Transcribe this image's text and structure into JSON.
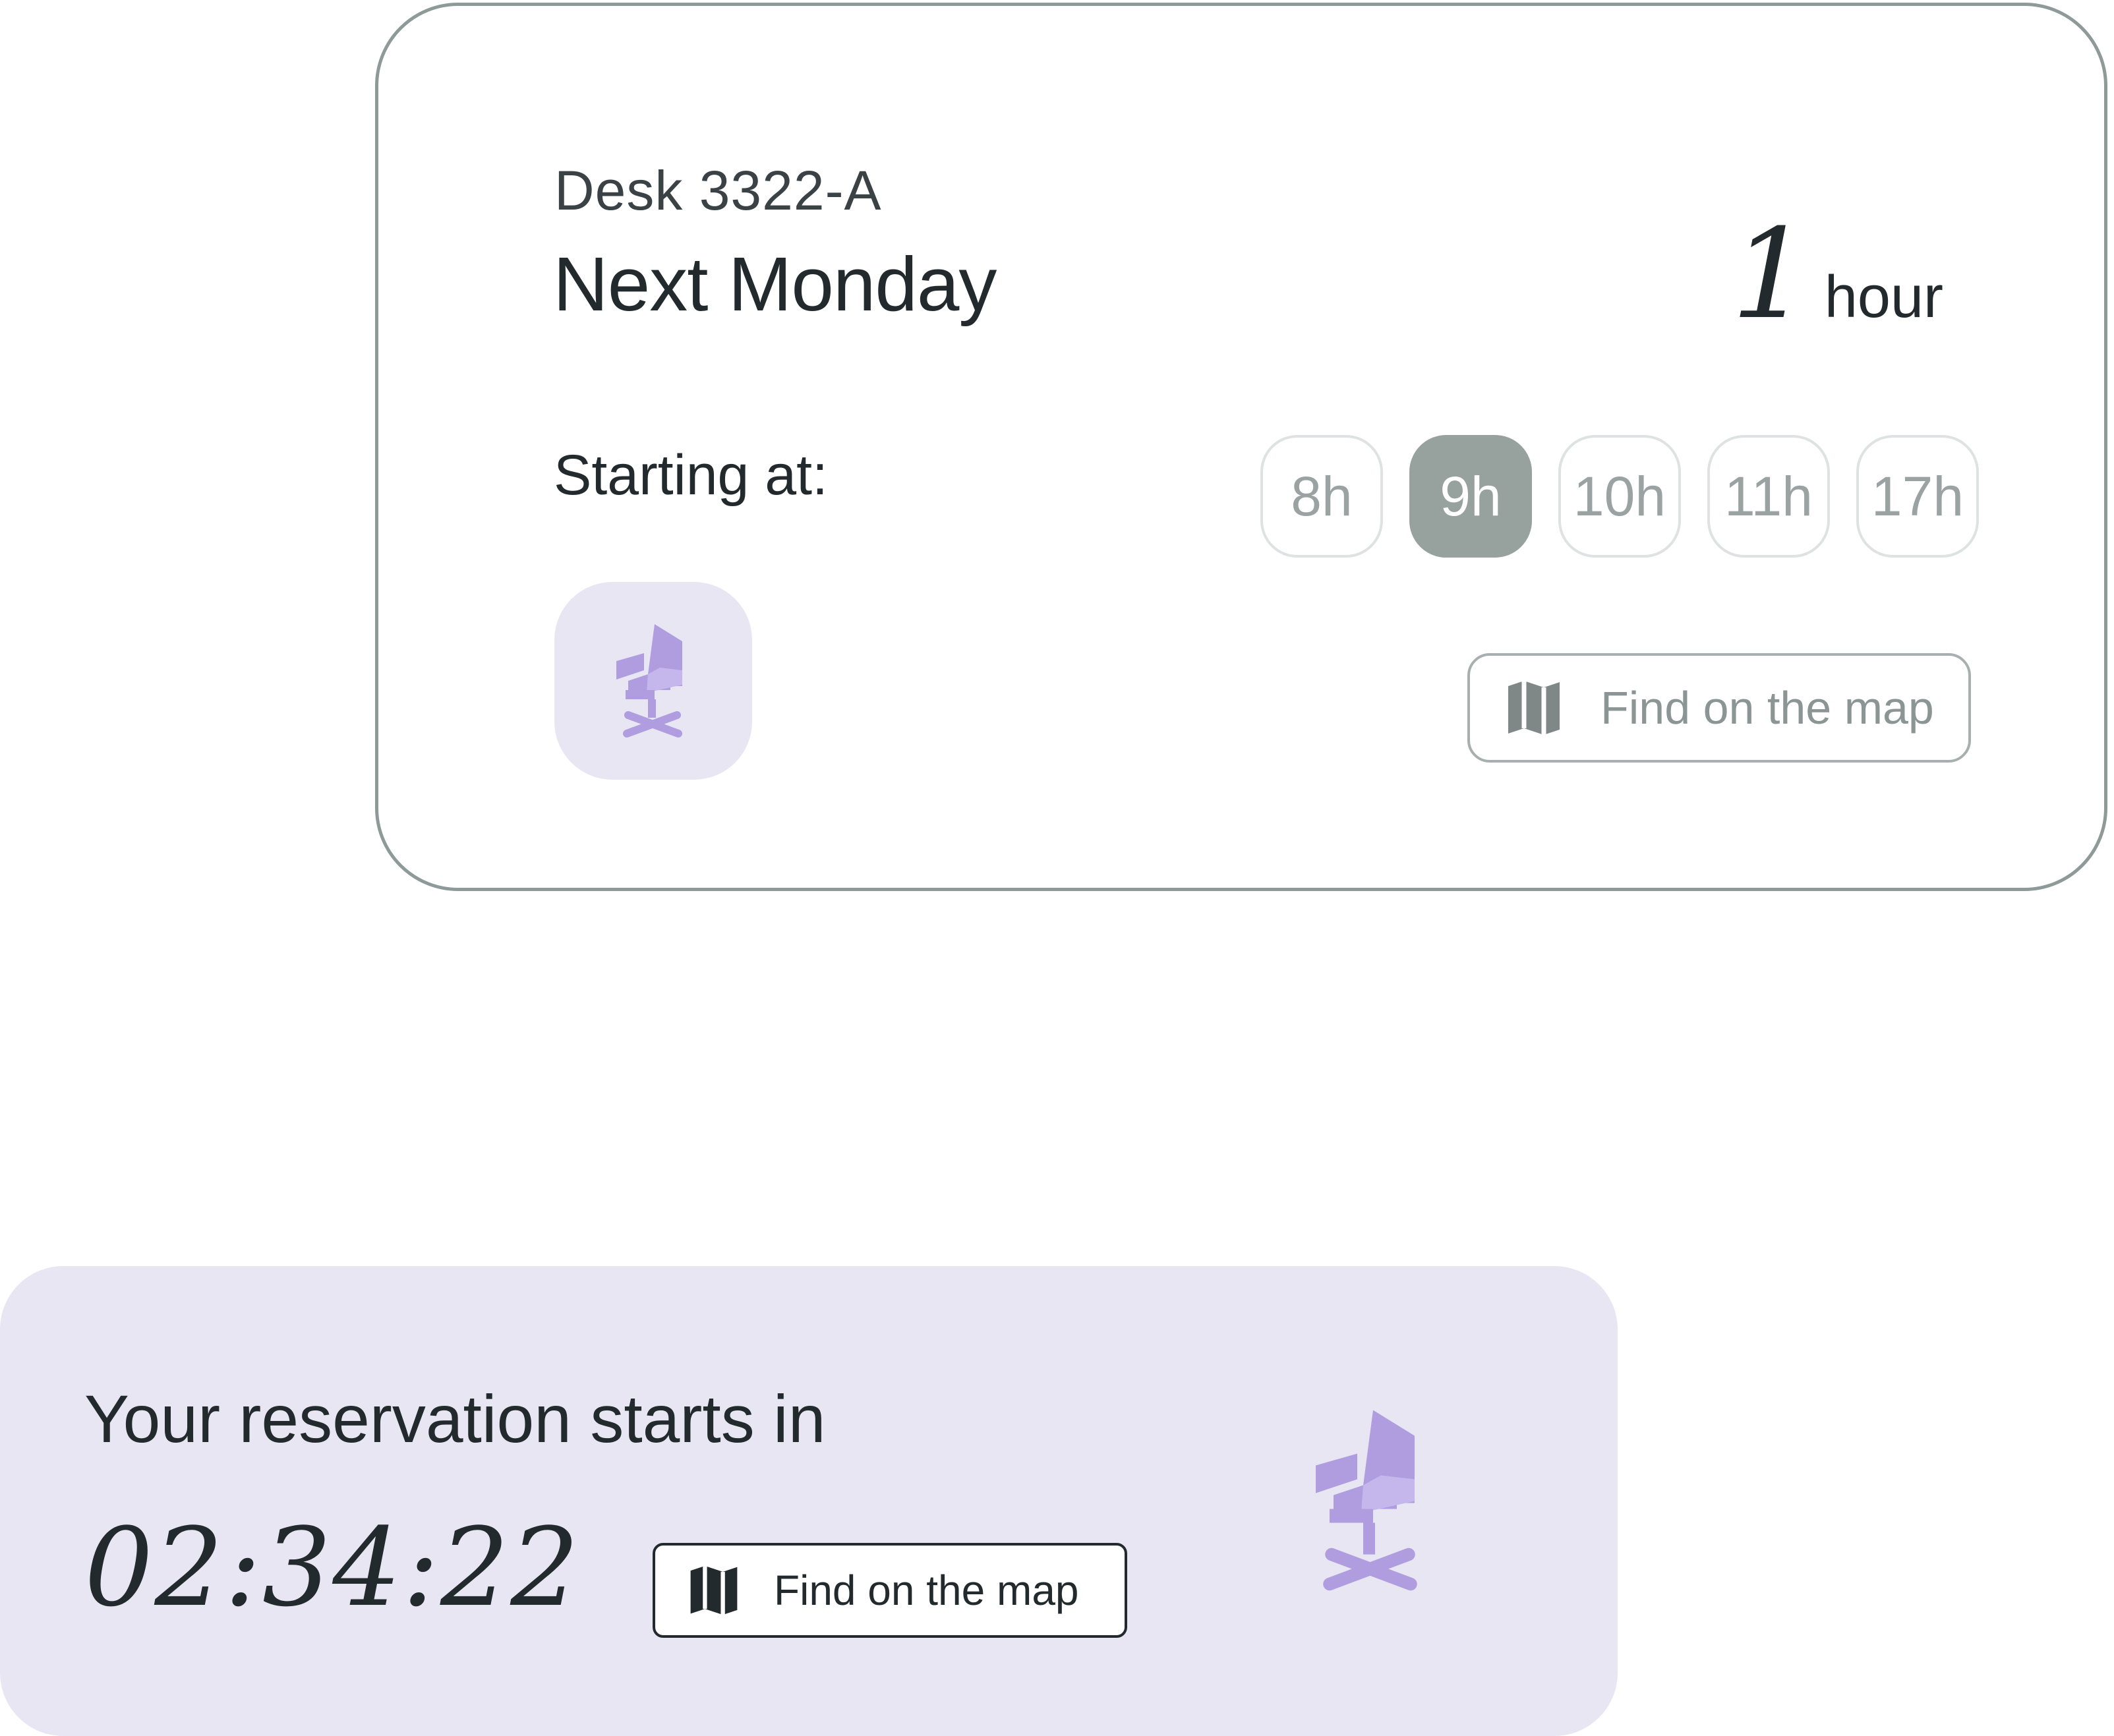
{
  "reservation_card": {
    "desk": "Desk 3322-A",
    "day": "Next Monday",
    "duration_value": "1",
    "duration_unit": "hour",
    "starting_label": "Starting at:",
    "hour_options": [
      "8h",
      "9h",
      "10h",
      "11h",
      "17h"
    ],
    "selected_hour": "9h",
    "map_button": "Find on the map",
    "icons": {
      "seat": "chair-icon",
      "map": "map-icon"
    }
  },
  "countdown_card": {
    "title": "Your reservation starts in",
    "time_remaining": "02:34:22",
    "map_button": "Find on the map",
    "icons": {
      "seat": "chair-icon",
      "map": "map-icon"
    }
  },
  "colors": {
    "accent_purple": "#b09ddf",
    "tile_purple_bg": "#e9e6f4",
    "countdown_bg": "#e8e6f3",
    "selected_chip": "#97a19e",
    "card_border": "#8d9a97",
    "text_dark": "#232a2d"
  }
}
